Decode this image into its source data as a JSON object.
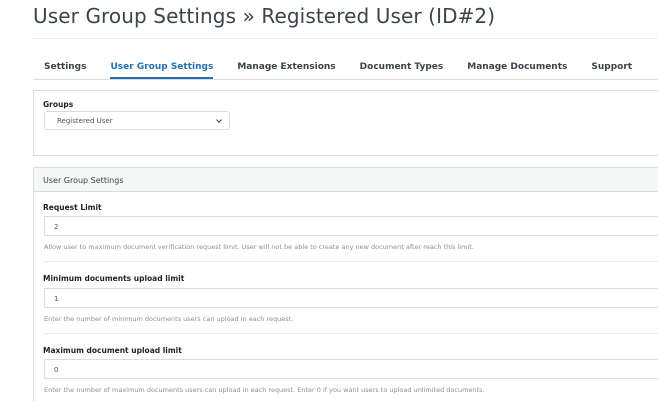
{
  "page": {
    "title": "User Group Settings » Registered User (ID#2)"
  },
  "tabs": [
    {
      "label": "Settings"
    },
    {
      "label": "User Group Settings"
    },
    {
      "label": "Manage Extensions"
    },
    {
      "label": "Document Types"
    },
    {
      "label": "Manage Documents"
    },
    {
      "label": "Support"
    }
  ],
  "active_tab": "User Group Settings",
  "groups": {
    "label": "Groups",
    "selected": "Registered User"
  },
  "settings": {
    "header": "User Group Settings",
    "fields": [
      {
        "label": "Request Limit",
        "value": "2",
        "help": "Allow user to maximum document verification request limit. User will not be able to create any new document after reach this limit."
      },
      {
        "label": "Minimum documents upload limit",
        "value": "1",
        "help": "Enter the number of minimum documents users can upload in each request."
      },
      {
        "label": "Maximum document upload limit",
        "value": "0",
        "help": "Enter the number of maximum documents users can upload in each request. Enter 0 if you want users to upload unlimited documents."
      }
    ]
  },
  "colors": {
    "accent": "#2271b1",
    "text": "#3c434a",
    "help": "#8c8f94",
    "border": "#dcdcde"
  }
}
